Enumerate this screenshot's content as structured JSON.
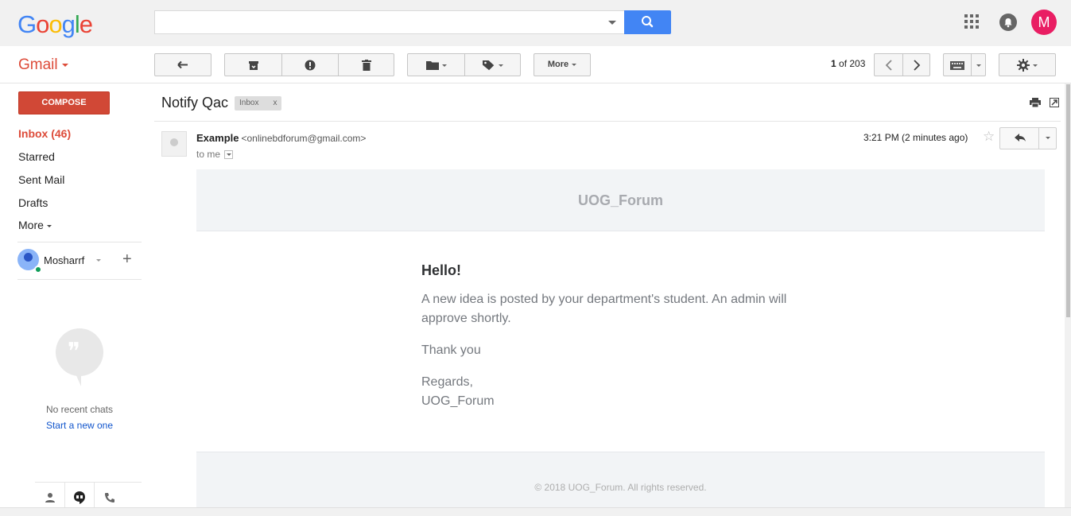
{
  "brand": {
    "logo": [
      "G",
      "o",
      "o",
      "g",
      "l",
      "e"
    ],
    "logo_colors": [
      "#4285f4",
      "#ea4335",
      "#fbbc05",
      "#4285f4",
      "#34a853",
      "#ea4335"
    ]
  },
  "topbar": {
    "search_placeholder": "",
    "avatar_initial": "M"
  },
  "toolbar": {
    "more_label": "More",
    "page_current": "1",
    "page_of": "of 203"
  },
  "sidebar": {
    "app_label": "Gmail",
    "compose_label": "COMPOSE",
    "nav": [
      {
        "label": "Inbox (46)",
        "active": true
      },
      {
        "label": "Starred",
        "active": false
      },
      {
        "label": "Sent Mail",
        "active": false
      },
      {
        "label": "Drafts",
        "active": false
      },
      {
        "label": "More",
        "active": false
      }
    ],
    "user_name": "Mosharrf",
    "no_chats": "No recent chats",
    "start_new": "Start a new one"
  },
  "message": {
    "subject": "Notify Qac",
    "label": "Inbox",
    "label_remove": "x",
    "sender_name": "Example",
    "sender_email": "<onlinebdforum@gmail.com>",
    "to": "to me",
    "timestamp": "3:21 PM (2 minutes ago)"
  },
  "email_body": {
    "header": "UOG_Forum",
    "greeting": "Hello!",
    "paragraph1": "A new idea is posted by your department's student. An admin will approve shortly.",
    "paragraph2": "Thank you",
    "regards": "Regards,",
    "signature": "UOG_Forum",
    "footer": "© 2018 UOG_Forum. All rights reserved."
  }
}
